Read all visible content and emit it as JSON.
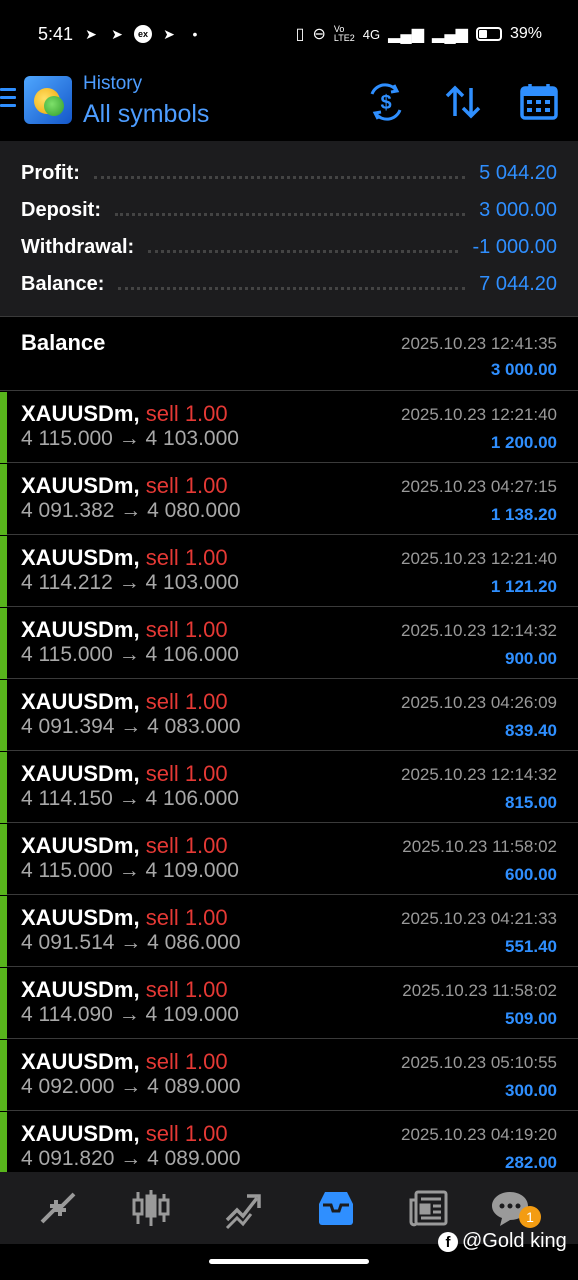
{
  "status_bar": {
    "time": "5:41",
    "battery": "39%",
    "network": "4G"
  },
  "header": {
    "subtitle": "History",
    "title": "All symbols"
  },
  "summary": {
    "profit_label": "Profit:",
    "profit_value": "5 044.20",
    "deposit_label": "Deposit:",
    "deposit_value": "3 000.00",
    "withdrawal_label": "Withdrawal:",
    "withdrawal_value": "-1 000.00",
    "balance_label": "Balance:",
    "balance_value": "7 044.20"
  },
  "balance_entry": {
    "name": "Balance",
    "time": "2025.10.23 12:41:35",
    "amount": "3 000.00"
  },
  "deals": [
    {
      "symbol": "XAUUSDm,",
      "type": "sell 1.00",
      "prices": "4 115.000 → 4 103.000",
      "time": "2025.10.23 12:21:40",
      "profit": "1 200.00"
    },
    {
      "symbol": "XAUUSDm,",
      "type": "sell 1.00",
      "prices": "4 091.382 → 4 080.000",
      "time": "2025.10.23 04:27:15",
      "profit": "1 138.20"
    },
    {
      "symbol": "XAUUSDm,",
      "type": "sell 1.00",
      "prices": "4 114.212 → 4 103.000",
      "time": "2025.10.23 12:21:40",
      "profit": "1 121.20"
    },
    {
      "symbol": "XAUUSDm,",
      "type": "sell 1.00",
      "prices": "4 115.000 → 4 106.000",
      "time": "2025.10.23 12:14:32",
      "profit": "900.00"
    },
    {
      "symbol": "XAUUSDm,",
      "type": "sell 1.00",
      "prices": "4 091.394 → 4 083.000",
      "time": "2025.10.23 04:26:09",
      "profit": "839.40"
    },
    {
      "symbol": "XAUUSDm,",
      "type": "sell 1.00",
      "prices": "4 114.150 → 4 106.000",
      "time": "2025.10.23 12:14:32",
      "profit": "815.00"
    },
    {
      "symbol": "XAUUSDm,",
      "type": "sell 1.00",
      "prices": "4 115.000 → 4 109.000",
      "time": "2025.10.23 11:58:02",
      "profit": "600.00"
    },
    {
      "symbol": "XAUUSDm,",
      "type": "sell 1.00",
      "prices": "4 091.514 → 4 086.000",
      "time": "2025.10.23 04:21:33",
      "profit": "551.40"
    },
    {
      "symbol": "XAUUSDm,",
      "type": "sell 1.00",
      "prices": "4 114.090 → 4 109.000",
      "time": "2025.10.23 11:58:02",
      "profit": "509.00"
    },
    {
      "symbol": "XAUUSDm,",
      "type": "sell 1.00",
      "prices": "4 092.000 → 4 089.000",
      "time": "2025.10.23 05:10:55",
      "profit": "300.00"
    },
    {
      "symbol": "XAUUSDm,",
      "type": "sell 1.00",
      "prices": "4 091.820 → 4 089.000",
      "time": "2025.10.23 04:19:20",
      "profit": "282.00"
    }
  ],
  "bottom_nav": {
    "items": [
      "quotes-icon",
      "chart-icon",
      "trade-icon",
      "history-icon",
      "news-icon",
      "chat-icon"
    ],
    "active": "history-icon",
    "chat_badge": "1"
  },
  "watermark": "@Gold king",
  "colors": {
    "accent": "#2f8fff",
    "sell": "#e53935",
    "profit_bar": "#58b51c",
    "summary_bg": "#1c1c1e"
  }
}
